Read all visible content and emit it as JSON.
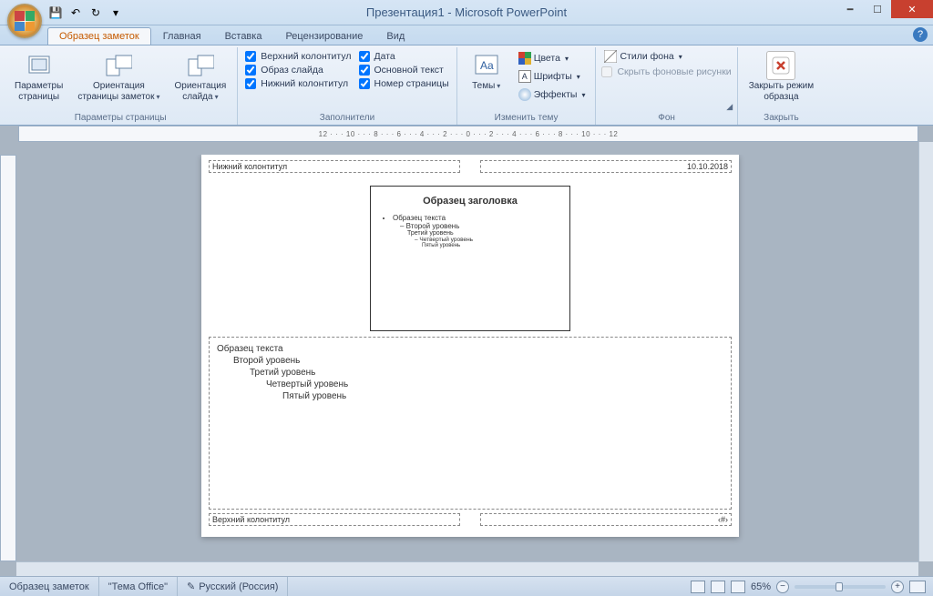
{
  "title": "Презентация1 - Microsoft PowerPoint",
  "qat": {
    "save": "💾",
    "undo": "↶",
    "redo": "↻"
  },
  "tabs": {
    "active": "Образец заметок",
    "items": [
      "Главная",
      "Вставка",
      "Рецензирование",
      "Вид"
    ]
  },
  "ribbon": {
    "page_params": {
      "label": "Параметры страницы",
      "page_setup": "Параметры\nстраницы",
      "notes_orient": "Ориентация\nстраницы заметок",
      "slide_orient": "Ориентация\nслайда"
    },
    "placeholders": {
      "label": "Заполнители",
      "col1": [
        "Верхний колонтитул",
        "Образ слайда",
        "Нижний колонтитул"
      ],
      "col2": [
        "Дата",
        "Основной текст",
        "Номер страницы"
      ]
    },
    "theme": {
      "label": "Изменить тему",
      "themes": "Темы",
      "colors": "Цвета",
      "fonts": "Шрифты",
      "effects": "Эффекты"
    },
    "background": {
      "label": "Фон",
      "styles": "Стили фона",
      "hide": "Скрыть фоновые рисунки"
    },
    "close": {
      "label": "Закрыть",
      "btn": "Закрыть режим\nобразца"
    }
  },
  "ruler_h": "12 · · · 10 · · · 8 · · · 6 · · · 4 · · · 2 · · · 0 · · · 2 · · · 4 · · · 6 · · · 8 · · · 10 · · · 12",
  "page": {
    "footer_ph": "Нижний колонтитул",
    "date": "10.10.2018",
    "header_ph": "Верхний колонтитул",
    "page_num": "‹#›",
    "slide": {
      "title": "Образец заголовка",
      "l1": "Образец текста",
      "l2": "Второй уровень",
      "l3": "Третий уровень",
      "l4": "Четвертый уровень",
      "l5": "Пятый уровень"
    },
    "notes": {
      "l1": "Образец текста",
      "l2": "Второй уровень",
      "l3": "Третий уровень",
      "l4": "Четвертый уровень",
      "l5": "Пятый уровень"
    }
  },
  "status": {
    "master": "Образец заметок",
    "theme": "\"Тема Office\"",
    "lang": "Русский (Россия)",
    "zoom": "65%"
  }
}
